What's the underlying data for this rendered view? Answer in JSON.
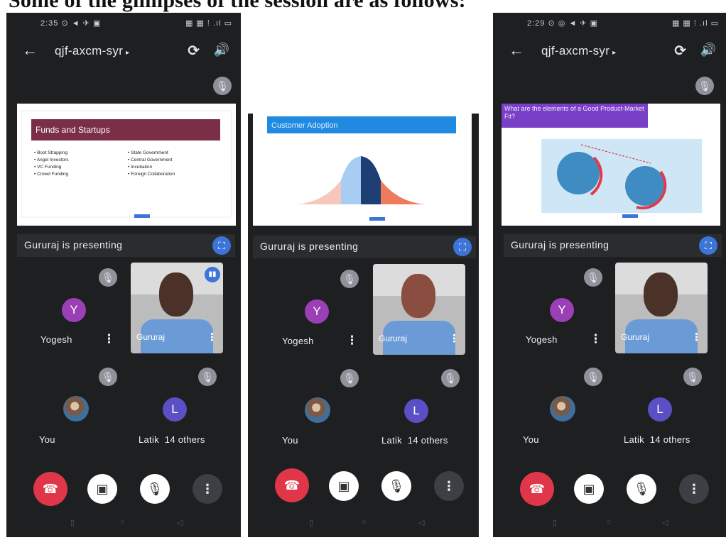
{
  "caption": "Some of the glimpses of the session are as follows:",
  "screens": [
    {
      "status_left": "2:35 ⊙ ◄ ✈ ▣",
      "status_right": "▦ ▦ ⁞ .ıl ▭",
      "meeting_code": "qjf-axcm-syr",
      "slide": {
        "title": "Funds and Startups",
        "col1": [
          "• Boot Strapping",
          "• Angel Investors",
          "• VC Funding",
          "• Crowd Funding"
        ],
        "col2": [
          "• State Government",
          "• Central Government",
          "• Incubation",
          "• Foreign Collaboration"
        ]
      },
      "presenting": "Gururaj is presenting",
      "tiles": {
        "y_initial": "Y",
        "y_name": "Yogesh",
        "g_name": "Gururaj",
        "you_name": "You",
        "l_initial": "L",
        "l_name": "Latik",
        "others": "14 others"
      }
    },
    {
      "slide": {
        "title": "Customer Adoption"
      },
      "presenting": "Gururaj is presenting",
      "tiles": {
        "y_initial": "Y",
        "y_name": "Yogesh",
        "g_name": "Gururaj",
        "you_name": "You",
        "l_initial": "L",
        "l_name": "Latik",
        "others": "14 others"
      }
    },
    {
      "status_left": "2:29 ⊙ ◎ ◄ ✈ ▣",
      "status_right": "▦ ▦ ⁞ .ıl ▭",
      "meeting_code": "qjf-axcm-syr",
      "slide": {
        "title": "What are the elements of a Good Product-Market Fit?"
      },
      "presenting": "Gururaj is presenting",
      "tiles": {
        "y_initial": "Y",
        "y_name": "Yogesh",
        "g_name": "Gururaj",
        "you_name": "You",
        "l_initial": "L",
        "l_name": "Latik",
        "others": "14 others"
      }
    }
  ],
  "icons": {
    "back": "←",
    "caret": "▸",
    "camera_switch": "⟳",
    "speaker": "🔊",
    "mic_off": "🎙",
    "fullscreen": "⛶",
    "more": "⋮",
    "end_call": "☎",
    "camera_off": "▣",
    "nav": [
      "▯",
      "○",
      "◁"
    ]
  },
  "colors": {
    "end_call": "#e0364a",
    "accent": "#3c74d8",
    "avatar_y": "#9b3fb6",
    "avatar_l": "#5a4fc4",
    "slide1_header": "#7b2f47",
    "slide2_header": "#1f8ae0",
    "slide3_header": "#7a3fc6"
  }
}
